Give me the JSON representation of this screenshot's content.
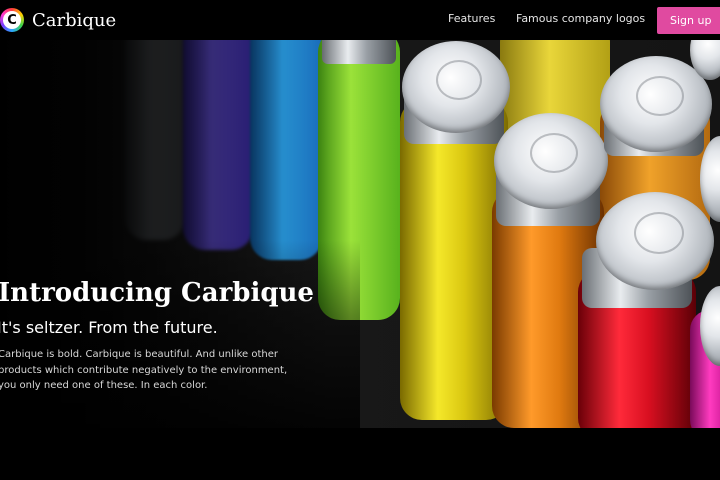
{
  "brand": {
    "name": "Carbique",
    "mark": "C"
  },
  "nav": {
    "links": [
      "Features",
      "Famous company logos"
    ],
    "signup_label": "Sign up"
  },
  "hero": {
    "title": "Introducing Carbique",
    "subtitle": "It's seltzer. From the future.",
    "description": "Carbique is bold. Carbique is beautiful. And unlike other products which contribute negatively to the environment, you only need one of these. In each color."
  },
  "colors": {
    "accent": "#e04aa0",
    "background": "#000000"
  }
}
